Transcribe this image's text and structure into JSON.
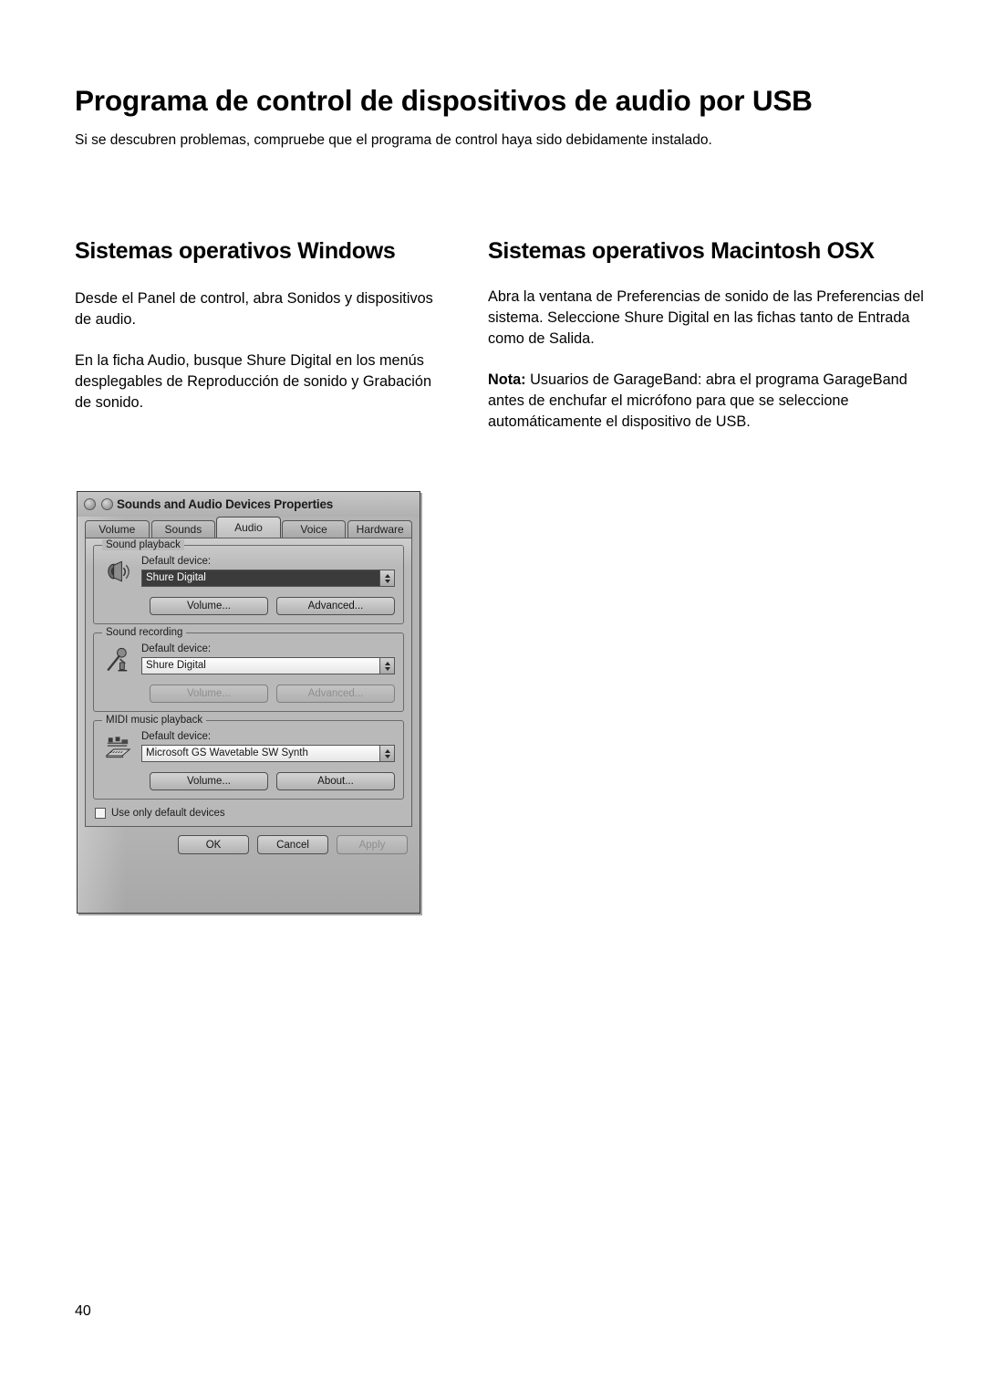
{
  "page": {
    "title": "Programa de control de dispositivos de audio por USB",
    "subtitle": "Si se descubren problemas, compruebe que el programa de control haya sido debidamente instalado.",
    "number": "40"
  },
  "columns": {
    "left": {
      "heading": "Sistemas operativos Windows",
      "paragraphs": [
        "Desde el Panel de control, abra Sonidos y dispositivos de audio.",
        "En la ficha Audio, busque Shure Digital en los menús desplegables de Reproducción de sonido y Grabación de sonido."
      ]
    },
    "right": {
      "heading": "Sistemas operativos Macintosh OSX",
      "paragraphs": [
        "Abra la ventana de Preferencias de sonido de las Preferencias del sistema. Seleccione Shure Digital en las fichas tanto de Entrada como de Salida."
      ],
      "note_label": "Nota:",
      "note_text": " Usuarios de GarageBand: abra el programa GarageBand antes de enchufar el micrófono para que se seleccione automáticamente el dispositivo de USB."
    }
  },
  "dialog": {
    "title": "Sounds and Audio Devices Properties",
    "tabs": [
      {
        "label": "Volume",
        "active": false
      },
      {
        "label": "Sounds",
        "active": false
      },
      {
        "label": "Audio",
        "active": true
      },
      {
        "label": "Voice",
        "active": false
      },
      {
        "label": "Hardware",
        "active": false
      }
    ],
    "groups": [
      {
        "title": "Sound playback",
        "icon": "speaker-icon",
        "field_label": "Default device:",
        "device": "Shure Digital",
        "selected": true,
        "buttons": [
          {
            "label": "Volume...",
            "disabled": false
          },
          {
            "label": "Advanced...",
            "disabled": false
          }
        ]
      },
      {
        "title": "Sound recording",
        "icon": "microphone-icon",
        "field_label": "Default device:",
        "device": "Shure Digital",
        "selected": false,
        "buttons": [
          {
            "label": "Volume...",
            "disabled": true
          },
          {
            "label": "Advanced...",
            "disabled": true
          }
        ]
      },
      {
        "title": "MIDI music playback",
        "icon": "midi-keyboard-icon",
        "field_label": "Default device:",
        "device": "Microsoft GS Wavetable SW Synth",
        "selected": false,
        "buttons": [
          {
            "label": "Volume...",
            "disabled": false
          },
          {
            "label": "About...",
            "disabled": false
          }
        ]
      }
    ],
    "checkbox": {
      "label": "Use only default devices",
      "checked": false
    },
    "footer_buttons": [
      {
        "label": "OK",
        "disabled": false
      },
      {
        "label": "Cancel",
        "disabled": false
      },
      {
        "label": "Apply",
        "disabled": true
      }
    ]
  },
  "colors": {
    "page_background": "#ffffff",
    "text": "#000000",
    "dialog_face": "#b4b4b4",
    "dialog_border": "#3a3a3a",
    "combo_selected_background": "#3b3b3b",
    "combo_selected_text": "#ffffff"
  }
}
